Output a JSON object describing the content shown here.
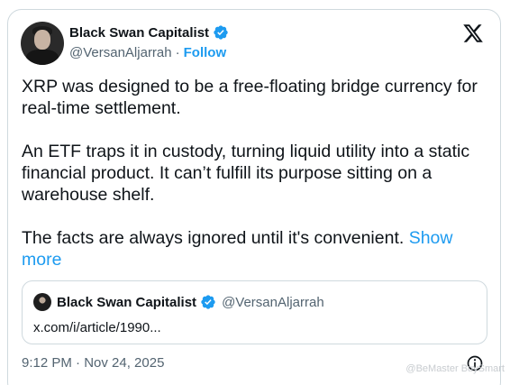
{
  "author": {
    "display_name": "Black Swan Capitalist",
    "handle": "@VersanAljarrah",
    "separator": "·",
    "follow_label": "Follow"
  },
  "tweet": {
    "paragraph_1": "XRP was designed to be a free-floating bridge currency for real-time settlement.",
    "paragraph_2": "An ETF traps it in custody, turning liquid utility into a static financial product. It can’t fulfill its purpose sitting on a warehouse shelf.",
    "paragraph_3": "The facts are always ignored until it's convenient.",
    "show_more_label": "Show more"
  },
  "quoted": {
    "display_name": "Black Swan Capitalist",
    "handle": "@VersanAljarrah",
    "link_text": "x.com/i/article/1990..."
  },
  "timestamp": "9:12 PM · Nov 24, 2025",
  "watermark": "@BeMaster BuySmart",
  "colors": {
    "accent": "#1d9bf0",
    "text": "#0f1419",
    "secondary_text": "#536471",
    "border": "#cfd9de"
  },
  "icons": [
    "verified-badge-icon",
    "x-logo-icon",
    "info-icon"
  ]
}
